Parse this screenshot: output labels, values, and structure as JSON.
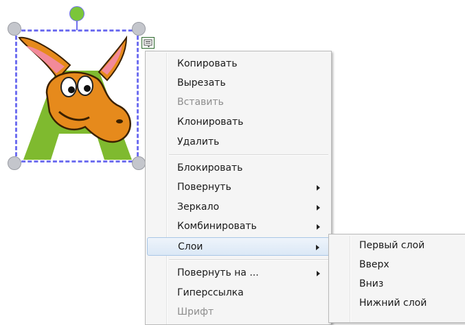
{
  "context_menu": {
    "items": [
      {
        "label": "Копировать"
      },
      {
        "label": "Вырезать"
      },
      {
        "label": "Вставить"
      },
      {
        "label": "Клонировать"
      },
      {
        "label": "Удалить"
      },
      {
        "label": "Блокировать"
      },
      {
        "label": "Повернуть"
      },
      {
        "label": "Зеркало"
      },
      {
        "label": "Комбинировать"
      },
      {
        "label": "Слои"
      },
      {
        "label": "Повернуть на ..."
      },
      {
        "label": "Гиперссылка"
      },
      {
        "label": "Шрифт"
      }
    ]
  },
  "layers_submenu": {
    "items": [
      {
        "label": "Первый слой"
      },
      {
        "label": "Вверх"
      },
      {
        "label": "Вниз"
      },
      {
        "label": "Нижний слой"
      }
    ]
  },
  "colors": {
    "selection": "#6f6ff0",
    "rotate_handle": "#7bc63a",
    "menu_bg": "#f5f5f5",
    "hover_bg": "#dbe8f6",
    "disabled_text": "#8d8d8d"
  }
}
